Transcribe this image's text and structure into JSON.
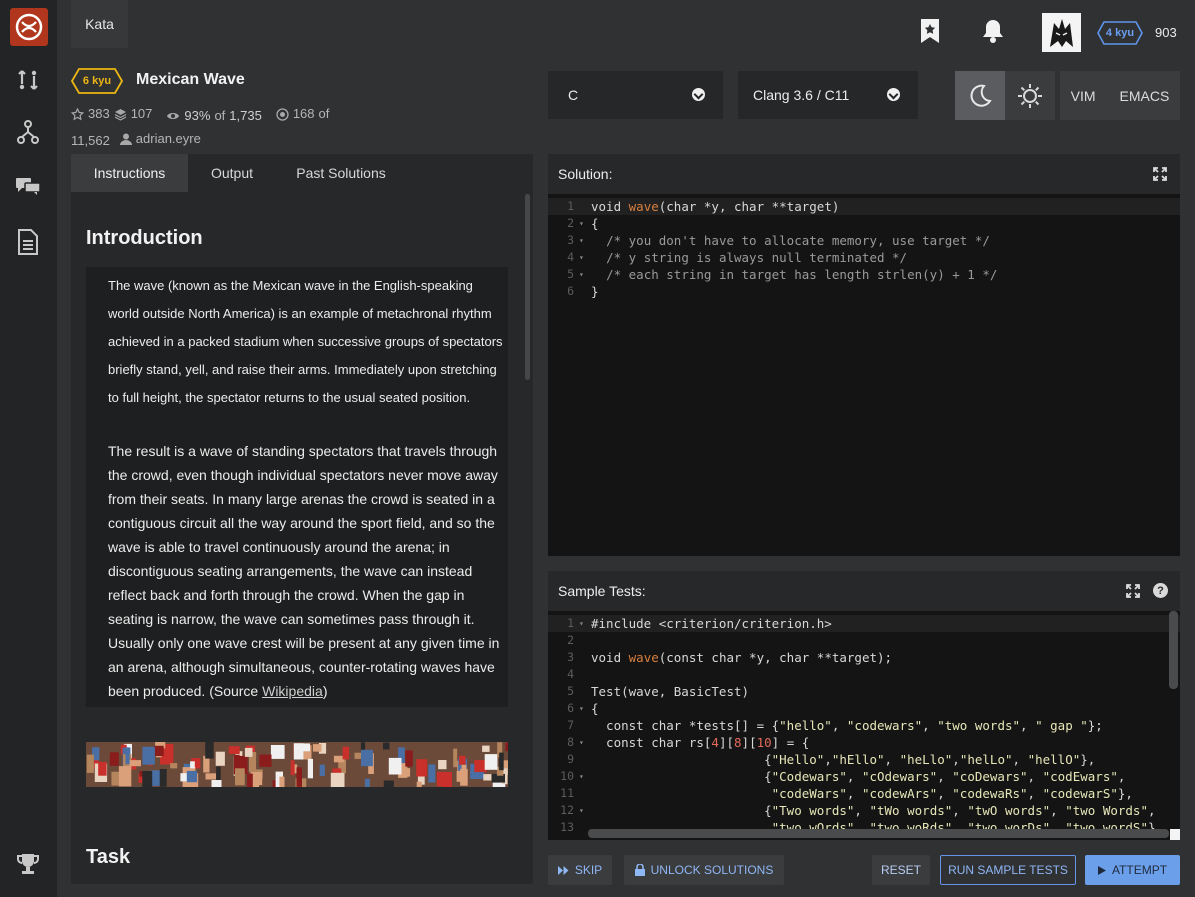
{
  "nav": {
    "kata_tab": "Kata",
    "rank": "4 kyu",
    "honor": "903",
    "rail_icons": [
      "codewars-logo-icon",
      "practice-icon",
      "fork-icon",
      "discuss-icon",
      "docs-icon",
      "trophy-icon"
    ]
  },
  "kata": {
    "rank": "6 kyu",
    "title": "Mexican Wave",
    "stars": "383",
    "collections": "107",
    "satisfaction": "93%",
    "satisfaction_of": "of",
    "votes": "1,735",
    "completed": "168",
    "completed_of": "of",
    "attempts": "11,562",
    "author": "adrian.eyre"
  },
  "selectors": {
    "language": "C",
    "version": "Clang 3.6 / C11",
    "vim": "VIM",
    "emacs": "EMACS"
  },
  "tabs": [
    "Instructions",
    "Output",
    "Past Solutions"
  ],
  "instructions": {
    "intro_heading": "Introduction",
    "para1": "The wave (known as the Mexican wave in the English-speaking world outside North America) is an example of metachronal rhythm achieved in a packed stadium when successive groups of spectators briefly stand, yell, and raise their arms. Immediately upon stretching to full height, the spectator returns to the usual seated position.",
    "para2": "The result is a wave of standing spectators that travels through the crowd, even though individual spectators never move away from their seats. In many large arenas the crowd is seated in a contiguous circuit all the way around the sport field, and so the wave is able to travel continuously around the arena; in discontiguous seating arrangements, the wave can instead reflect back and forth through the crowd. When the gap in seating is narrow, the wave can sometimes pass through it. Usually only one wave crest will be present at any given time in an arena, although simultaneous, counter-rotating waves have been produced. (Source ",
    "para2_link": "Wikipedia",
    "para2_end": ")",
    "task_heading": "Task"
  },
  "solution": {
    "header": "Solution:",
    "lines": [
      {
        "n": "1",
        "fold": ""
      },
      {
        "n": "2",
        "fold": "▾"
      },
      {
        "n": "3",
        "fold": "▾"
      },
      {
        "n": "4",
        "fold": "▾"
      },
      {
        "n": "5",
        "fold": "▾"
      },
      {
        "n": "6",
        "fold": ""
      }
    ]
  },
  "tests": {
    "header": "Sample Tests:",
    "help": "?",
    "lines": [
      {
        "n": "1",
        "fold": "▾"
      },
      {
        "n": "2",
        "fold": ""
      },
      {
        "n": "3",
        "fold": ""
      },
      {
        "n": "4",
        "fold": ""
      },
      {
        "n": "5",
        "fold": ""
      },
      {
        "n": "6",
        "fold": "▾"
      },
      {
        "n": "7",
        "fold": ""
      },
      {
        "n": "8",
        "fold": "▾"
      },
      {
        "n": "9",
        "fold": ""
      },
      {
        "n": "10",
        "fold": "▾"
      },
      {
        "n": "11",
        "fold": ""
      },
      {
        "n": "12",
        "fold": "▾"
      },
      {
        "n": "13",
        "fold": ""
      }
    ]
  },
  "buttons": {
    "skip": "SKIP",
    "unlock": "UNLOCK SOLUTIONS",
    "reset": "RESET",
    "run": "RUN SAMPLE TESTS",
    "attempt": "ATTEMPT"
  }
}
